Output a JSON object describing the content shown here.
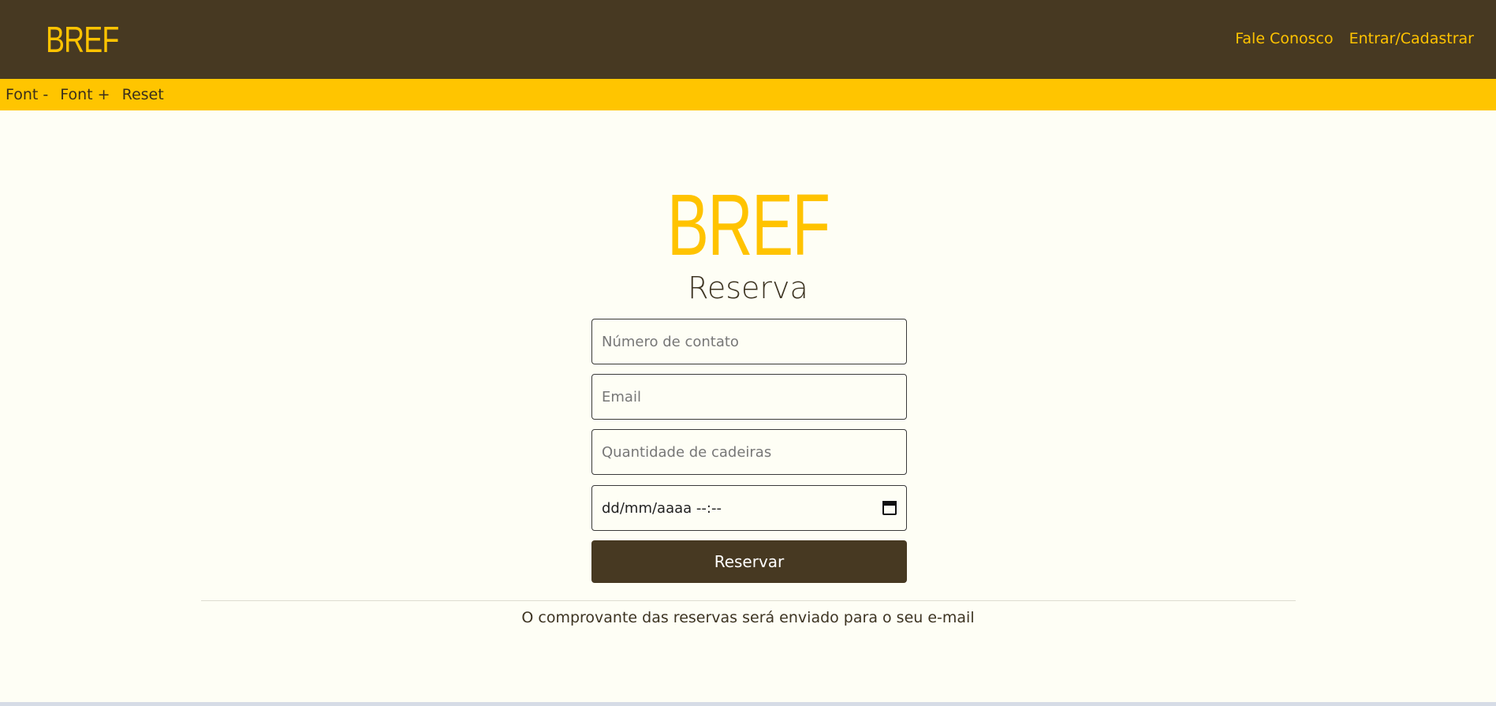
{
  "header": {
    "brand": "BREF",
    "nav": [
      "Fale Conosco",
      "Entrar/Cadastrar"
    ]
  },
  "font_controls": [
    "Font -",
    "Font +",
    "Reset"
  ],
  "main": {
    "title": "BREF",
    "subtitle": "Reserva",
    "fields": {
      "contact_placeholder": "Número de contato",
      "email_placeholder": "Email",
      "chairs_placeholder": "Quantidade de cadeiras",
      "datetime_value": "dd/mm/aaaa --:--"
    },
    "submit_label": "Reservar",
    "note": "O comprovante das reservas será enviado para o seu e-mail"
  },
  "icons": {
    "calendar": "calendar-icon"
  },
  "colors": {
    "header_bg": "#473922",
    "accent_yellow": "#ffc300",
    "fontbar_bg": "#ffc500",
    "page_bg": "#fefef5",
    "button_bg": "#473922"
  }
}
